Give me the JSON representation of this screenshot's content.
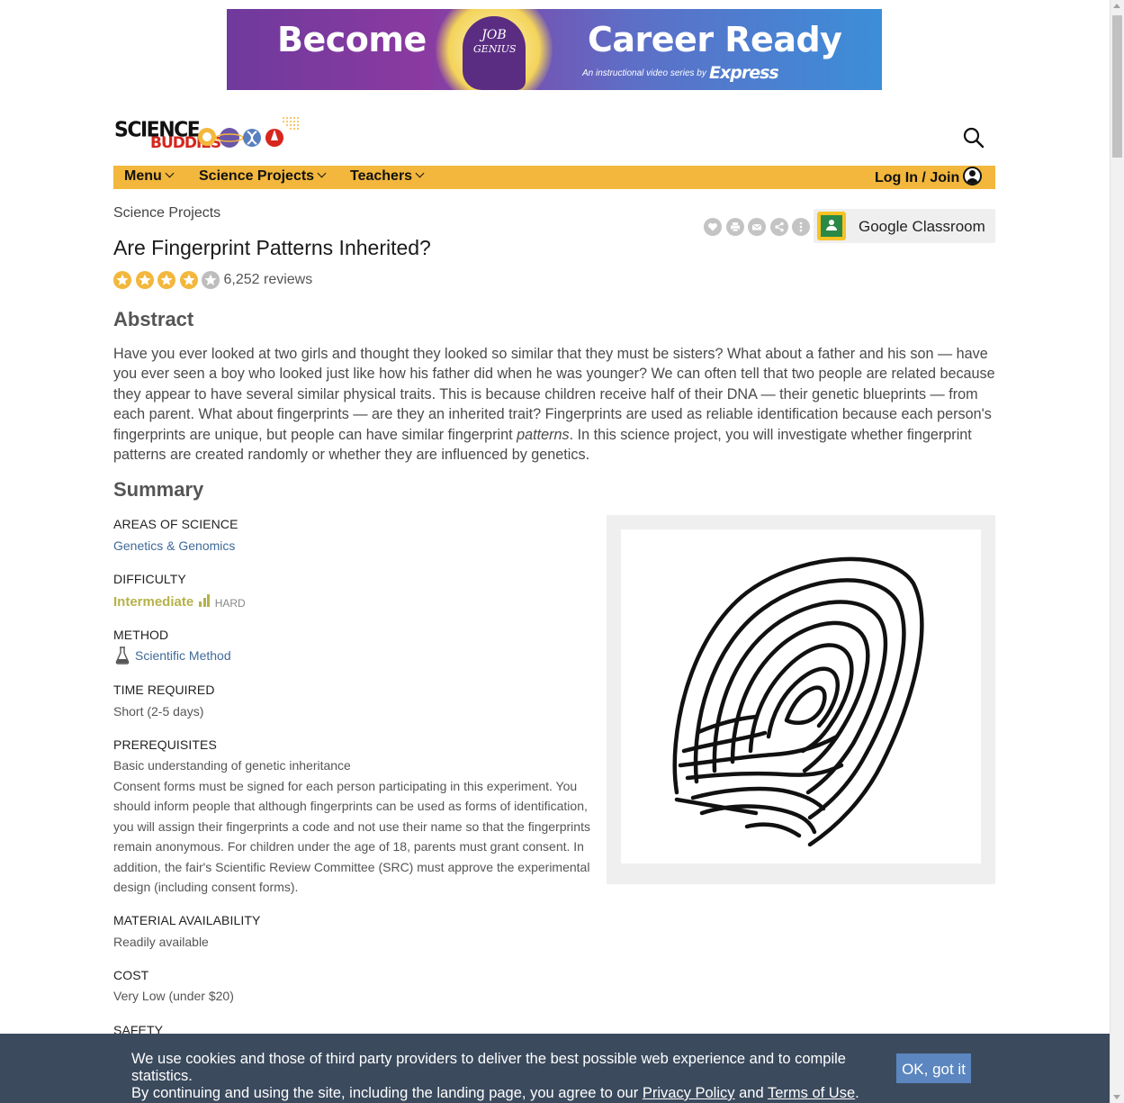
{
  "ad": {
    "left_text": "Become",
    "right_text": "Career Ready",
    "logo_line1": "JOB",
    "logo_line2": "GENIUS",
    "tagline": "An instructional video series by",
    "brand": "Express",
    "colors": {
      "start": "#6f3a9d",
      "end": "#3c8ed8",
      "glow": "#f3d35a"
    }
  },
  "header": {
    "logo_line1": "SCIENCE",
    "logo_line2": "BUDDIES",
    "search_icon": "search-icon"
  },
  "nav": {
    "menu": "Menu",
    "science_projects": "Science Projects",
    "teachers": "Teachers",
    "login": "Log In / Join",
    "accent": "#f2b73c"
  },
  "page": {
    "breadcrumb": "Science Projects",
    "title": "Are Fingerprint Patterns Inherited?",
    "rating": 4,
    "rating_max": 5,
    "reviews": "6,252 reviews",
    "google_classroom": "Google Classroom",
    "action_icons": [
      "heart-icon",
      "print-icon",
      "email-icon",
      "share-icon",
      "more-icon"
    ]
  },
  "abstract": {
    "heading": "Abstract",
    "text_before": "Have you ever looked at two girls and thought they looked so similar that they must be sisters? What about a father and his son — have you ever seen a boy who looked just like how his father did when he was younger? We can often tell that two people are related because they appear to have several similar physical traits. This is because children receive half of their DNA — their genetic blueprints — from each parent. What about fingerprints — are they an inherited trait? Fingerprints are used as reliable identification because each person's fingerprints are unique, but people can have similar fingerprint ",
    "text_em": "patterns",
    "text_after": ". In this science project, you will investigate whether fingerprint patterns are created randomly or whether they are influenced by genetics."
  },
  "summary": {
    "heading": "Summary",
    "areas_label": "AREAS OF SCIENCE",
    "areas_value": "Genetics & Genomics",
    "difficulty_label": "DIFFICULTY",
    "difficulty_value": "Intermediate",
    "difficulty_hard": "HARD",
    "difficulty_level": 3,
    "method_label": "METHOD",
    "method_value": "Scientific Method",
    "time_label": "TIME REQUIRED",
    "time_value": "Short (2-5 days)",
    "prereq_label": "PREREQUISITES",
    "prereq_line1": "Basic understanding of genetic inheritance",
    "prereq_line2": "Consent forms must be signed for each person participating in this experiment. You should inform people that although fingerprints can be used as forms of identification, you will assign their fingerprints a code and not use their name so that the fingerprints remain anonymous. For children under the age of 18, parents must grant consent. In addition, the fair's Scientific Review Committee (SRC) must approve the experimental design (including consent forms).",
    "material_label": "MATERIAL AVAILABILITY",
    "material_value": "Readily available",
    "cost_label": "COST",
    "cost_value": "Very Low (under $20)",
    "safety_label": "SAFETY"
  },
  "cookie": {
    "text_line1": "We use cookies and those of third party providers to deliver the best possible web experience and to compile statistics.",
    "text_line2_before": "By continuing and using the site, including the landing page, you agree to our ",
    "privacy": "Privacy Policy",
    "and": " and ",
    "terms": "Terms of Use",
    "period": ".",
    "ok_button": "OK, got it"
  }
}
